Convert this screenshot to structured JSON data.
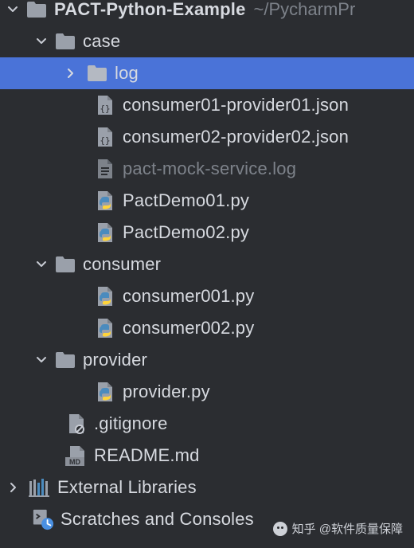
{
  "project_tree": {
    "root": {
      "label": "PACT-Python-Example",
      "path": "~/PycharmPr"
    },
    "items": [
      {
        "label": "case",
        "type": "folder",
        "expanded": true
      },
      {
        "label": "log",
        "type": "folder",
        "expanded": false,
        "selected": true
      },
      {
        "label": "consumer01-provider01.json",
        "type": "json"
      },
      {
        "label": "consumer02-provider02.json",
        "type": "json"
      },
      {
        "label": "pact-mock-service.log",
        "type": "log",
        "muted": true
      },
      {
        "label": "PactDemo01.py",
        "type": "python"
      },
      {
        "label": "PactDemo02.py",
        "type": "python"
      },
      {
        "label": "consumer",
        "type": "folder",
        "expanded": true
      },
      {
        "label": "consumer001.py",
        "type": "python"
      },
      {
        "label": "consumer002.py",
        "type": "python"
      },
      {
        "label": "provider",
        "type": "folder",
        "expanded": true
      },
      {
        "label": "provider.py",
        "type": "python"
      },
      {
        "label": ".gitignore",
        "type": "gitignore"
      },
      {
        "label": "README.md",
        "type": "markdown"
      },
      {
        "label": "External Libraries",
        "type": "libraries"
      },
      {
        "label": "Scratches and Consoles",
        "type": "scratches"
      }
    ]
  },
  "watermark": {
    "text": "知乎 @软件质量保障"
  },
  "colors": {
    "background": "#2b2d31",
    "selected": "#4a73d8",
    "text": "#d7dae0",
    "muted": "#7d828a",
    "folder": "#9aa0aa",
    "python_blue": "#4b8bbe",
    "python_yellow": "#ffd43b"
  },
  "icons": {
    "chevron_down": "chevron-down-icon",
    "chevron_right": "chevron-right-icon",
    "folder": "folder-icon",
    "json": "json-file-icon",
    "log": "log-file-icon",
    "python": "python-file-icon",
    "gitignore": "gitignore-icon",
    "markdown": "markdown-icon",
    "libraries": "libraries-icon",
    "scratches": "scratches-icon"
  }
}
